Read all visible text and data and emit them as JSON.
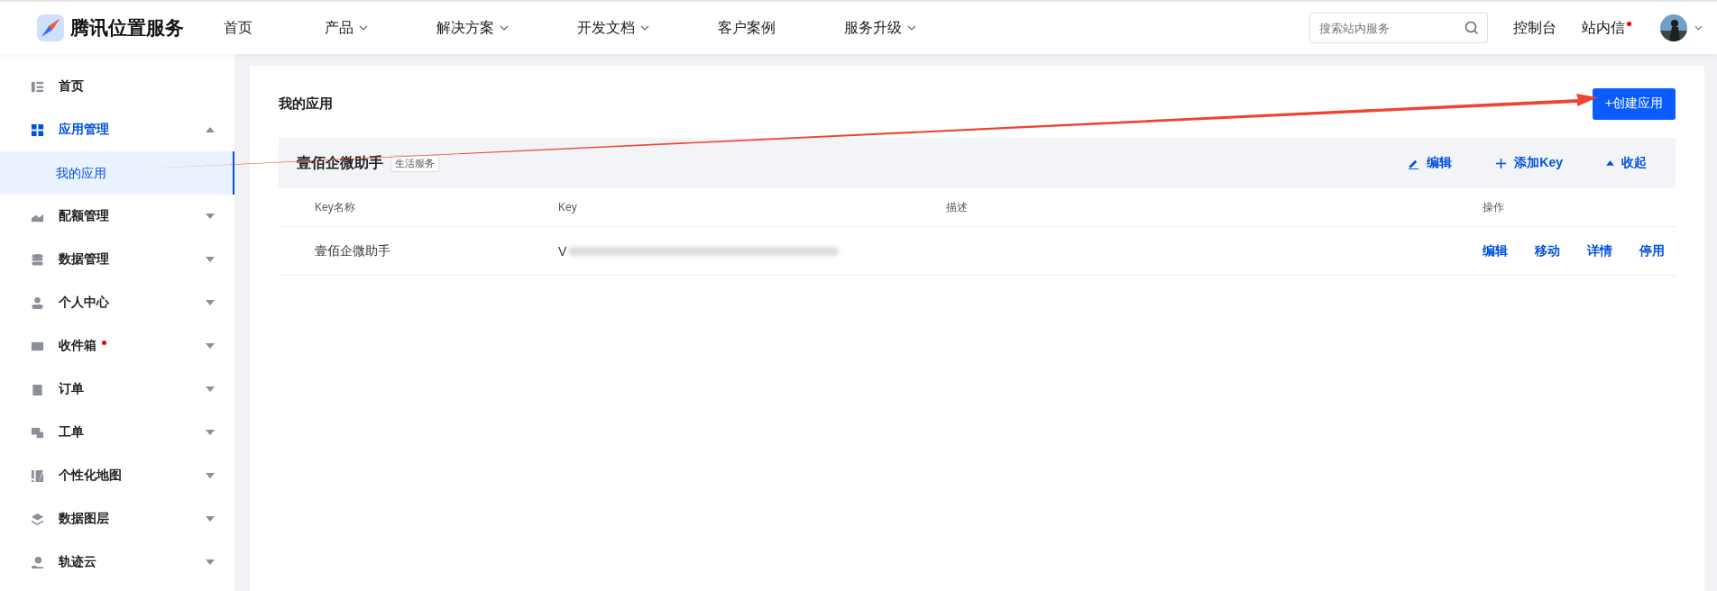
{
  "header": {
    "logo": "腾讯位置服务",
    "nav": [
      {
        "label": "首页",
        "has_menu": false
      },
      {
        "label": "产品",
        "has_menu": true
      },
      {
        "label": "解决方案",
        "has_menu": true
      },
      {
        "label": "开发文档",
        "has_menu": true
      },
      {
        "label": "客户案例",
        "has_menu": false
      },
      {
        "label": "服务升级",
        "has_menu": true
      }
    ],
    "search": {
      "placeholder": "搜索站内服务"
    },
    "links": [
      {
        "label": "控制台",
        "dot": false
      },
      {
        "label": "站内信",
        "dot": true
      }
    ]
  },
  "sidebar": {
    "items": [
      {
        "label": "首页",
        "expandable": false,
        "expanded": false,
        "dot": false
      },
      {
        "label": "应用管理",
        "expandable": true,
        "expanded": true,
        "dot": false,
        "children": [
          {
            "label": "我的应用",
            "selected": true
          }
        ]
      },
      {
        "label": "配额管理",
        "expandable": true,
        "expanded": false,
        "dot": false
      },
      {
        "label": "数据管理",
        "expandable": true,
        "expanded": false,
        "dot": false
      },
      {
        "label": "个人中心",
        "expandable": true,
        "expanded": false,
        "dot": false
      },
      {
        "label": "收件箱",
        "expandable": true,
        "expanded": false,
        "dot": true
      },
      {
        "label": "订单",
        "expandable": true,
        "expanded": false,
        "dot": false
      },
      {
        "label": "工单",
        "expandable": true,
        "expanded": false,
        "dot": false
      },
      {
        "label": "个性化地图",
        "expandable": true,
        "expanded": false,
        "dot": false
      },
      {
        "label": "数据图层",
        "expandable": true,
        "expanded": false,
        "dot": false
      },
      {
        "label": "轨迹云",
        "expandable": true,
        "expanded": false,
        "dot": false
      }
    ]
  },
  "content": {
    "title": "我的应用",
    "create_button": "+创建应用",
    "app": {
      "name": "壹佰企微助手",
      "tag": "生活服务",
      "actions": [
        {
          "label": "编辑",
          "kind": "edit"
        },
        {
          "label": "添加Key",
          "kind": "add"
        },
        {
          "label": "收起",
          "kind": "collapse"
        }
      ],
      "table": {
        "columns": [
          "Key名称",
          "Key",
          "描述",
          "操作"
        ],
        "rows": [
          {
            "name": "壹佰企微助手",
            "key": "V",
            "actions": [
              "编辑",
              "移动",
              "详情",
              "停用"
            ]
          }
        ]
      }
    }
  }
}
